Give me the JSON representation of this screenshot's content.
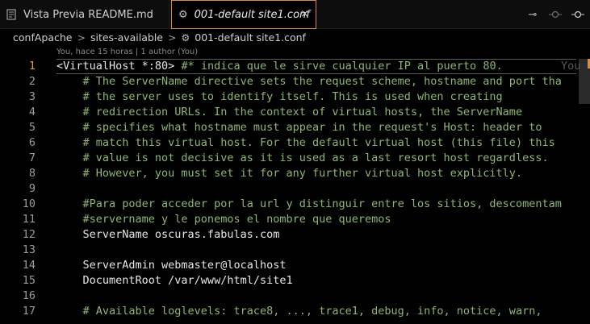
{
  "tabs": [
    {
      "label": "Vista Previa README.md",
      "icon": "preview-icon"
    },
    {
      "label": "001-default site1.conf",
      "icon": "gear-icon",
      "close": "×"
    }
  ],
  "actions": [
    {
      "icon": "source-control-icon",
      "glyph": "⊸"
    },
    {
      "icon": "previous-change-icon",
      "glyph": "↩"
    },
    {
      "icon": "next-change-icon",
      "glyph": "↪"
    }
  ],
  "breadcrumb": {
    "parts": [
      "confApache",
      "sites-available",
      "001-default site1.conf"
    ],
    "separator": ">"
  },
  "blame": {
    "codelens": "You, hace 15 horas | 1 author (You)",
    "inline": "You"
  },
  "editor": {
    "lines": [
      {
        "number": "1",
        "text": "<VirtualHost *:80>",
        "comment": " #* indica que le sirve cualquier IP al puerto 80."
      },
      {
        "number": "2",
        "text": "",
        "comment": "    # The ServerName directive sets the request scheme, hostname and port tha"
      },
      {
        "number": "3",
        "text": "",
        "comment": "    # the server uses to identify itself. This is used when creating"
      },
      {
        "number": "4",
        "text": "",
        "comment": "    # redirection URLs. In the context of virtual hosts, the ServerName"
      },
      {
        "number": "5",
        "text": "",
        "comment": "    # specifies what hostname must appear in the request's Host: header to"
      },
      {
        "number": "6",
        "text": "",
        "comment": "    # match this virtual host. For the default virtual host (this file) this"
      },
      {
        "number": "7",
        "text": "",
        "comment": "    # value is not decisive as it is used as a last resort host regardless."
      },
      {
        "number": "8",
        "text": "",
        "comment": "    # However, you must set it for any further virtual host explicitly."
      },
      {
        "number": "9",
        "text": "",
        "comment": ""
      },
      {
        "number": "10",
        "text": "",
        "comment": "    #Para poder acceder por la url y distinguir entre los sitios, descomentam"
      },
      {
        "number": "11",
        "text": "",
        "comment": "    #servername y le ponemos el nombre que queremos"
      },
      {
        "number": "12",
        "text": "    ServerName oscuras.fabulas.com",
        "comment": ""
      },
      {
        "number": "13",
        "text": "",
        "comment": ""
      },
      {
        "number": "14",
        "text": "    ServerAdmin webmaster@localhost",
        "comment": ""
      },
      {
        "number": "15",
        "text": "    DocumentRoot /var/www/html/site1",
        "comment": ""
      },
      {
        "number": "16",
        "text": "",
        "comment": ""
      },
      {
        "number": "17",
        "text": "",
        "comment": "    # Available loglevels: trace8, ..., trace1, debug, info, notice, warn,"
      }
    ]
  },
  "colors": {
    "accent": "#d98c3c",
    "comment": "#8fb573",
    "active_line_number": "#e0a24a"
  }
}
